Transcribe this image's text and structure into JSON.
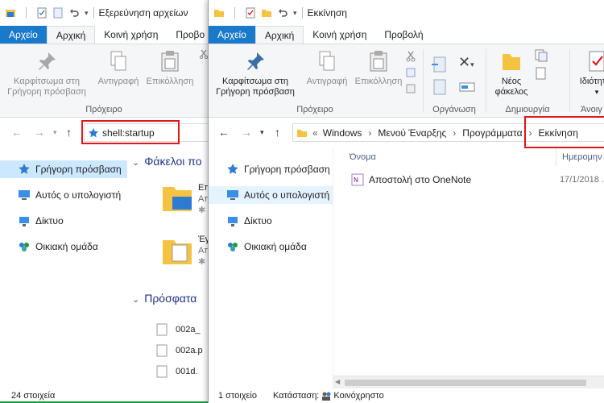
{
  "window_left": {
    "title": "Εξερεύνηση αρχείων",
    "tabs": [
      "Αρχείο",
      "Αρχική",
      "Κοινή χρήση",
      "Προβο"
    ],
    "ribbon": {
      "pin_label_1": "Καρφίτσωμα στη",
      "pin_label_2": "Γρήγορη πρόσβαση",
      "copy_label": "Αντιγραφή",
      "paste_label": "Επικόλληση",
      "group_clipboard": "Πρόχειρο"
    },
    "address_value": "shell:startup",
    "nav": [
      "Γρήγορη πρόσβαση",
      "Αυτός ο υπολογιστή",
      "Δίκτυο",
      "Οικιακή ομάδα"
    ],
    "content": {
      "frequent_header": "Φάκελοι πο",
      "recent_header": "Πρόσφατα",
      "folder1_name": "Επ",
      "folder1_sub": "Απ",
      "folder2_name": "Έγ",
      "folder2_sub": "Απ",
      "recent_files": [
        "002a_",
        "002a.p",
        "001d."
      ]
    },
    "status": "24 στοιχεία"
  },
  "window_right": {
    "title": "Εκκίνηση",
    "tabs": [
      "Αρχείο",
      "Αρχική",
      "Κοινή χρήση",
      "Προβολή"
    ],
    "ribbon": {
      "pin_label_1": "Καρφίτσωμα στη",
      "pin_label_2": "Γρήγορη πρόσβαση",
      "copy_label": "Αντιγραφή",
      "paste_label": "Επικόλληση",
      "group_clipboard": "Πρόχειρο",
      "group_organize": "Οργάνωση",
      "new_folder_1": "Νέος",
      "new_folder_2": "φάκελος",
      "group_new": "Δημιουργία",
      "properties_label": "Ιδιότητες",
      "group_open": "Άνοιγ"
    },
    "breadcrumb": {
      "prefix": "«",
      "items": [
        "Windows",
        "Μενού Έναρξης",
        "Προγράμματα",
        "Εκκίνηση"
      ]
    },
    "nav": [
      "Γρήγορη πρόσβαση",
      "Αυτός ο υπολογιστή",
      "Δίκτυο",
      "Οικιακή ομάδα"
    ],
    "columns": {
      "name": "Όνομα",
      "date": "Ημερομην"
    },
    "files": [
      {
        "name": "Αποστολή στο OneNote",
        "date": "17/1/2018 ."
      }
    ],
    "status": {
      "count": "1 στοιχείο",
      "state": "Κατάσταση:",
      "share": "Κοινόχρηστο"
    }
  },
  "colors": {
    "file_tab": "#1979ca",
    "highlight_box": "#e0161b",
    "nav_selected": "#cce8ff",
    "folder": "#f5c342"
  }
}
